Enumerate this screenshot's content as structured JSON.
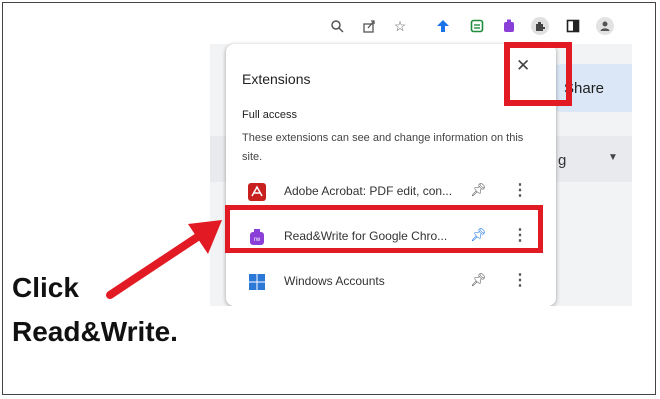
{
  "toolbar": {
    "icons": [
      "zoom-icon",
      "share-page-icon",
      "bookmark-star-icon",
      "extension-blue-icon",
      "extension-green-icon",
      "readwrite-toolbar-icon",
      "puzzle-extensions-icon",
      "side-panel-icon",
      "profile-icon"
    ]
  },
  "page": {
    "share_label": "Share",
    "dropdown_partial": "g"
  },
  "extensions_panel": {
    "title": "Extensions",
    "close_symbol": "✕",
    "section_heading": "Full access",
    "section_description": "These extensions can see and change information on this site.",
    "items": [
      {
        "name": "Adobe Acrobat: PDF edit, con...",
        "icon": "adobe-acrobat-icon",
        "icon_color": "#c7201e",
        "pinned": false
      },
      {
        "name": "Read&Write for Google Chro...",
        "icon": "readwrite-icon",
        "icon_color": "#8b3fd9",
        "pinned": true
      },
      {
        "name": "Windows Accounts",
        "icon": "windows-icon",
        "icon_color": "#2b78d6",
        "pinned": false
      }
    ]
  },
  "annotation": {
    "line1": "Click",
    "line2": "Read&Write.",
    "highlight_color": "#e21a23"
  }
}
